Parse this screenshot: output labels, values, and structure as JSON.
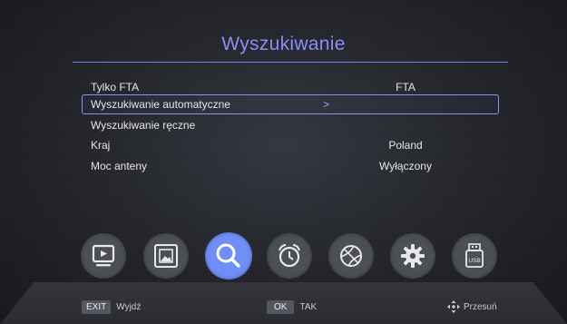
{
  "menu": {
    "title": "Wyszukiwanie",
    "items": [
      {
        "label": "Tylko FTA",
        "value": "FTA"
      },
      {
        "label": "Wyszukiwanie automatyczne",
        "value": "",
        "arrow": ">"
      },
      {
        "label": "Wyszukiwanie ręczne",
        "value": ""
      },
      {
        "label": "Kraj",
        "value": "Poland"
      },
      {
        "label": "Moc anteny",
        "value": "Wyłączony"
      }
    ]
  },
  "icons": [
    "tv-icon",
    "picture-icon",
    "search-icon",
    "alarm-clock-icon",
    "ball-icon",
    "gear-icon",
    "usb-icon"
  ],
  "footer": {
    "exit_key": "EXIT",
    "exit_label": "Wyjdź",
    "ok_key": "OK",
    "ok_label": "TAK",
    "move_label": "Przesuń"
  },
  "colors": {
    "accent": "#8a8cf7",
    "active_icon": "#6f8ef7"
  }
}
